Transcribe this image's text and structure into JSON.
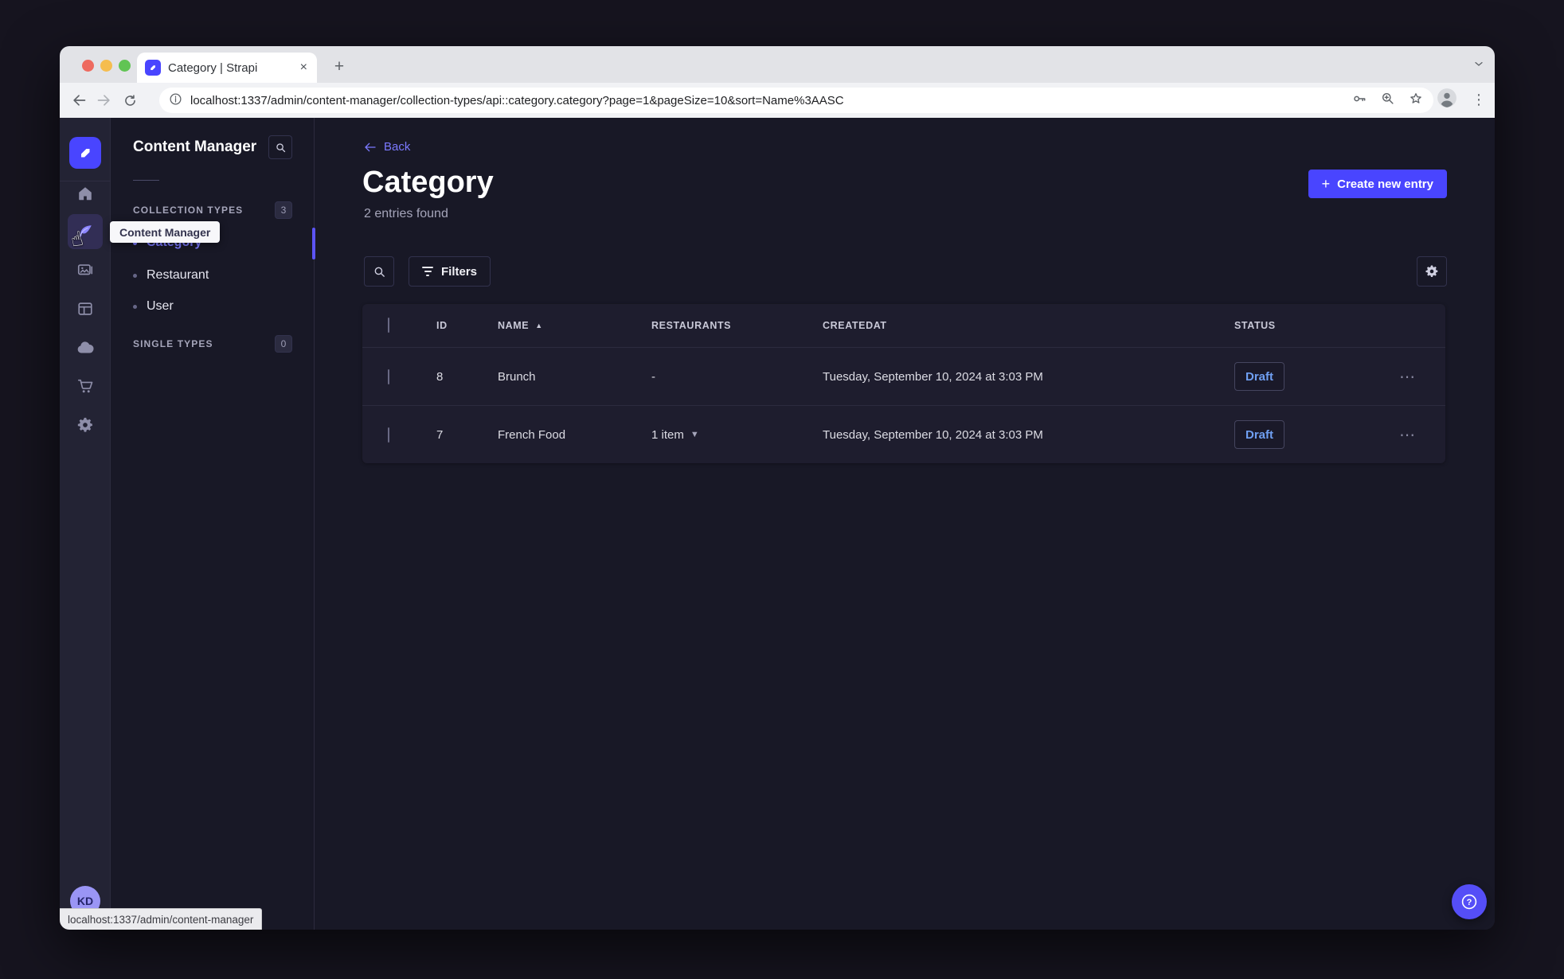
{
  "browser": {
    "tab_title": "Category | Strapi",
    "url": "localhost:1337/admin/content-manager/collection-types/api::category.category?page=1&pageSize=10&sort=Name%3AASC",
    "status_bar": "localhost:1337/admin/content-manager",
    "new_tab_glyph": "+",
    "close_tab_glyph": "×"
  },
  "colors": {
    "primary": "#4945ff",
    "link": "#7b79ff",
    "draft_text": "#6f9ff2",
    "surface": "#1e1d2e",
    "background": "#181826"
  },
  "rail": {
    "icons": [
      "strapi-logo",
      "home",
      "content-manager-pen",
      "media-library",
      "content-type-builder",
      "cloud",
      "marketplace",
      "settings"
    ],
    "avatar_initials": "KD"
  },
  "subnav": {
    "title": "Content Manager",
    "tooltip": "Content Manager",
    "collection_types_label": "COLLECTION TYPES",
    "collection_types_count": "3",
    "single_types_label": "SINGLE TYPES",
    "single_types_count": "0",
    "items": [
      {
        "label": "Category",
        "active": true
      },
      {
        "label": "Restaurant",
        "active": false
      },
      {
        "label": "User",
        "active": false
      }
    ]
  },
  "header": {
    "back_label": "Back",
    "title": "Category",
    "subtitle": "2 entries found",
    "create_button": "Create new entry"
  },
  "actions": {
    "filters_label": "Filters"
  },
  "table": {
    "headers": [
      "ID",
      "NAME",
      "RESTAURANTS",
      "CREATEDAT",
      "STATUS"
    ],
    "sorted_column": "NAME",
    "rows": [
      {
        "id": "8",
        "name": "Brunch",
        "restaurants": "-",
        "has_relation_caret": false,
        "createdAt": "Tuesday, September 10, 2024 at 3:03 PM",
        "status": "Draft"
      },
      {
        "id": "7",
        "name": "French Food",
        "restaurants": "1 item",
        "has_relation_caret": true,
        "createdAt": "Tuesday, September 10, 2024 at 3:03 PM",
        "status": "Draft"
      }
    ]
  }
}
